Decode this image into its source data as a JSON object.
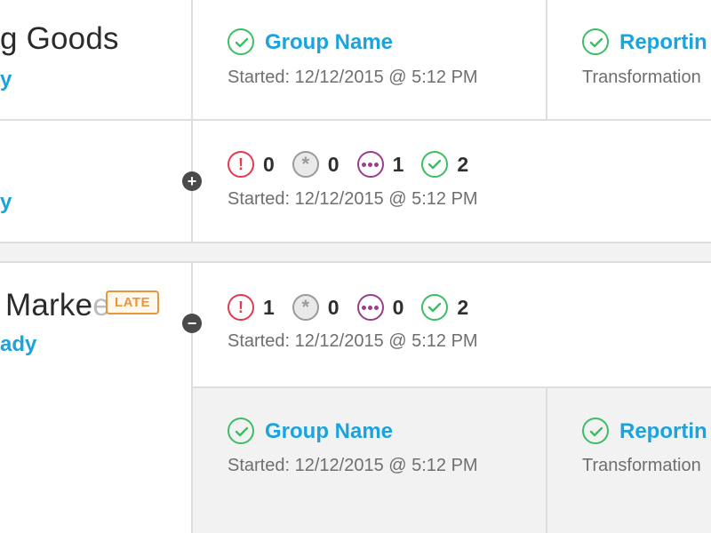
{
  "colors": {
    "accent_blue": "#1aa3dd",
    "success_green": "#3dbd64",
    "error_red": "#e8384f",
    "pending_gray": "#9a9a9a",
    "running_purple": "#9a3d8c",
    "late_orange": "#e8963a"
  },
  "rows": [
    {
      "title_visible": "g Goods",
      "link_visible": "y"
    },
    {
      "link_visible": "y",
      "toggle_symbol": "+",
      "summary": {
        "error_count": "0",
        "pending_count": "0",
        "running_count": "1",
        "done_count": "2",
        "started": "Started: 12/12/2015 @ 5:12 PM"
      }
    },
    {
      "title_visible": "Marke",
      "title_faded": "e",
      "link_visible": "ady",
      "badge": "LATE",
      "toggle_symbol": "−",
      "summary": {
        "error_count": "1",
        "pending_count": "0",
        "running_count": "0",
        "done_count": "2",
        "started": "Started: 12/12/2015 @ 5:12 PM"
      }
    }
  ],
  "jobs_top": [
    {
      "name": "Group Name",
      "meta": "Started: 12/12/2015 @ 5:12 PM",
      "icon": "check-circle-icon"
    },
    {
      "name": "Reportin",
      "meta": "Transformation",
      "icon": "check-circle-icon"
    }
  ],
  "jobs_bottom": [
    {
      "name": "Group Name",
      "meta": "Started: 12/12/2015 @ 5:12 PM",
      "icon": "check-circle-icon"
    },
    {
      "name": "Reportin",
      "meta": "Transformation",
      "icon": "check-circle-icon"
    }
  ]
}
